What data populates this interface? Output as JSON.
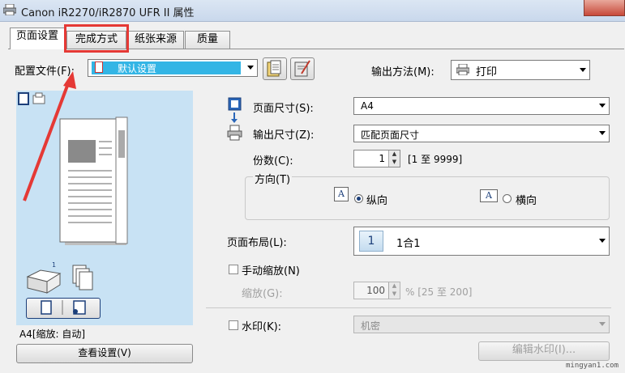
{
  "window": {
    "title": "Canon iR2270/iR2870 UFR II 属性"
  },
  "tabs": [
    {
      "label": "页面设置"
    },
    {
      "label": "完成方式"
    },
    {
      "label": "纸张来源"
    },
    {
      "label": "质量"
    }
  ],
  "profile": {
    "label": "配置文件(F):",
    "value": "默认设置"
  },
  "output_method": {
    "label": "输出方法(M):",
    "value": "打印"
  },
  "page_size": {
    "label": "页面尺寸(S):",
    "value": "A4"
  },
  "output_size": {
    "label": "输出尺寸(Z):",
    "value": "匹配页面尺寸"
  },
  "copies": {
    "label": "份数(C):",
    "value": "1",
    "range": "[1 至 9999]"
  },
  "orientation": {
    "label": "方向(T)",
    "portrait": "纵向",
    "landscape": "横向",
    "selected": "portrait"
  },
  "layout": {
    "label": "页面布局(L):",
    "value": "1合1",
    "icon_text": "1"
  },
  "manual_scaling": {
    "label": "手动缩放(N)",
    "scale_label": "缩放(G):",
    "scale_value": "100",
    "scale_range": "% [25 至 200]"
  },
  "watermark": {
    "label": "水印(K):",
    "value": "机密",
    "edit_button": "编辑水印(I)..."
  },
  "preview": {
    "status_text": "A4[缩放: 自动]",
    "view_settings_button": "查看设置(V)"
  },
  "watermark_site": "mingyan1.com",
  "colors": {
    "highlight": "#e53935",
    "profile_selected": "#33b5e5",
    "preview_bg": "#c8e2f4"
  }
}
